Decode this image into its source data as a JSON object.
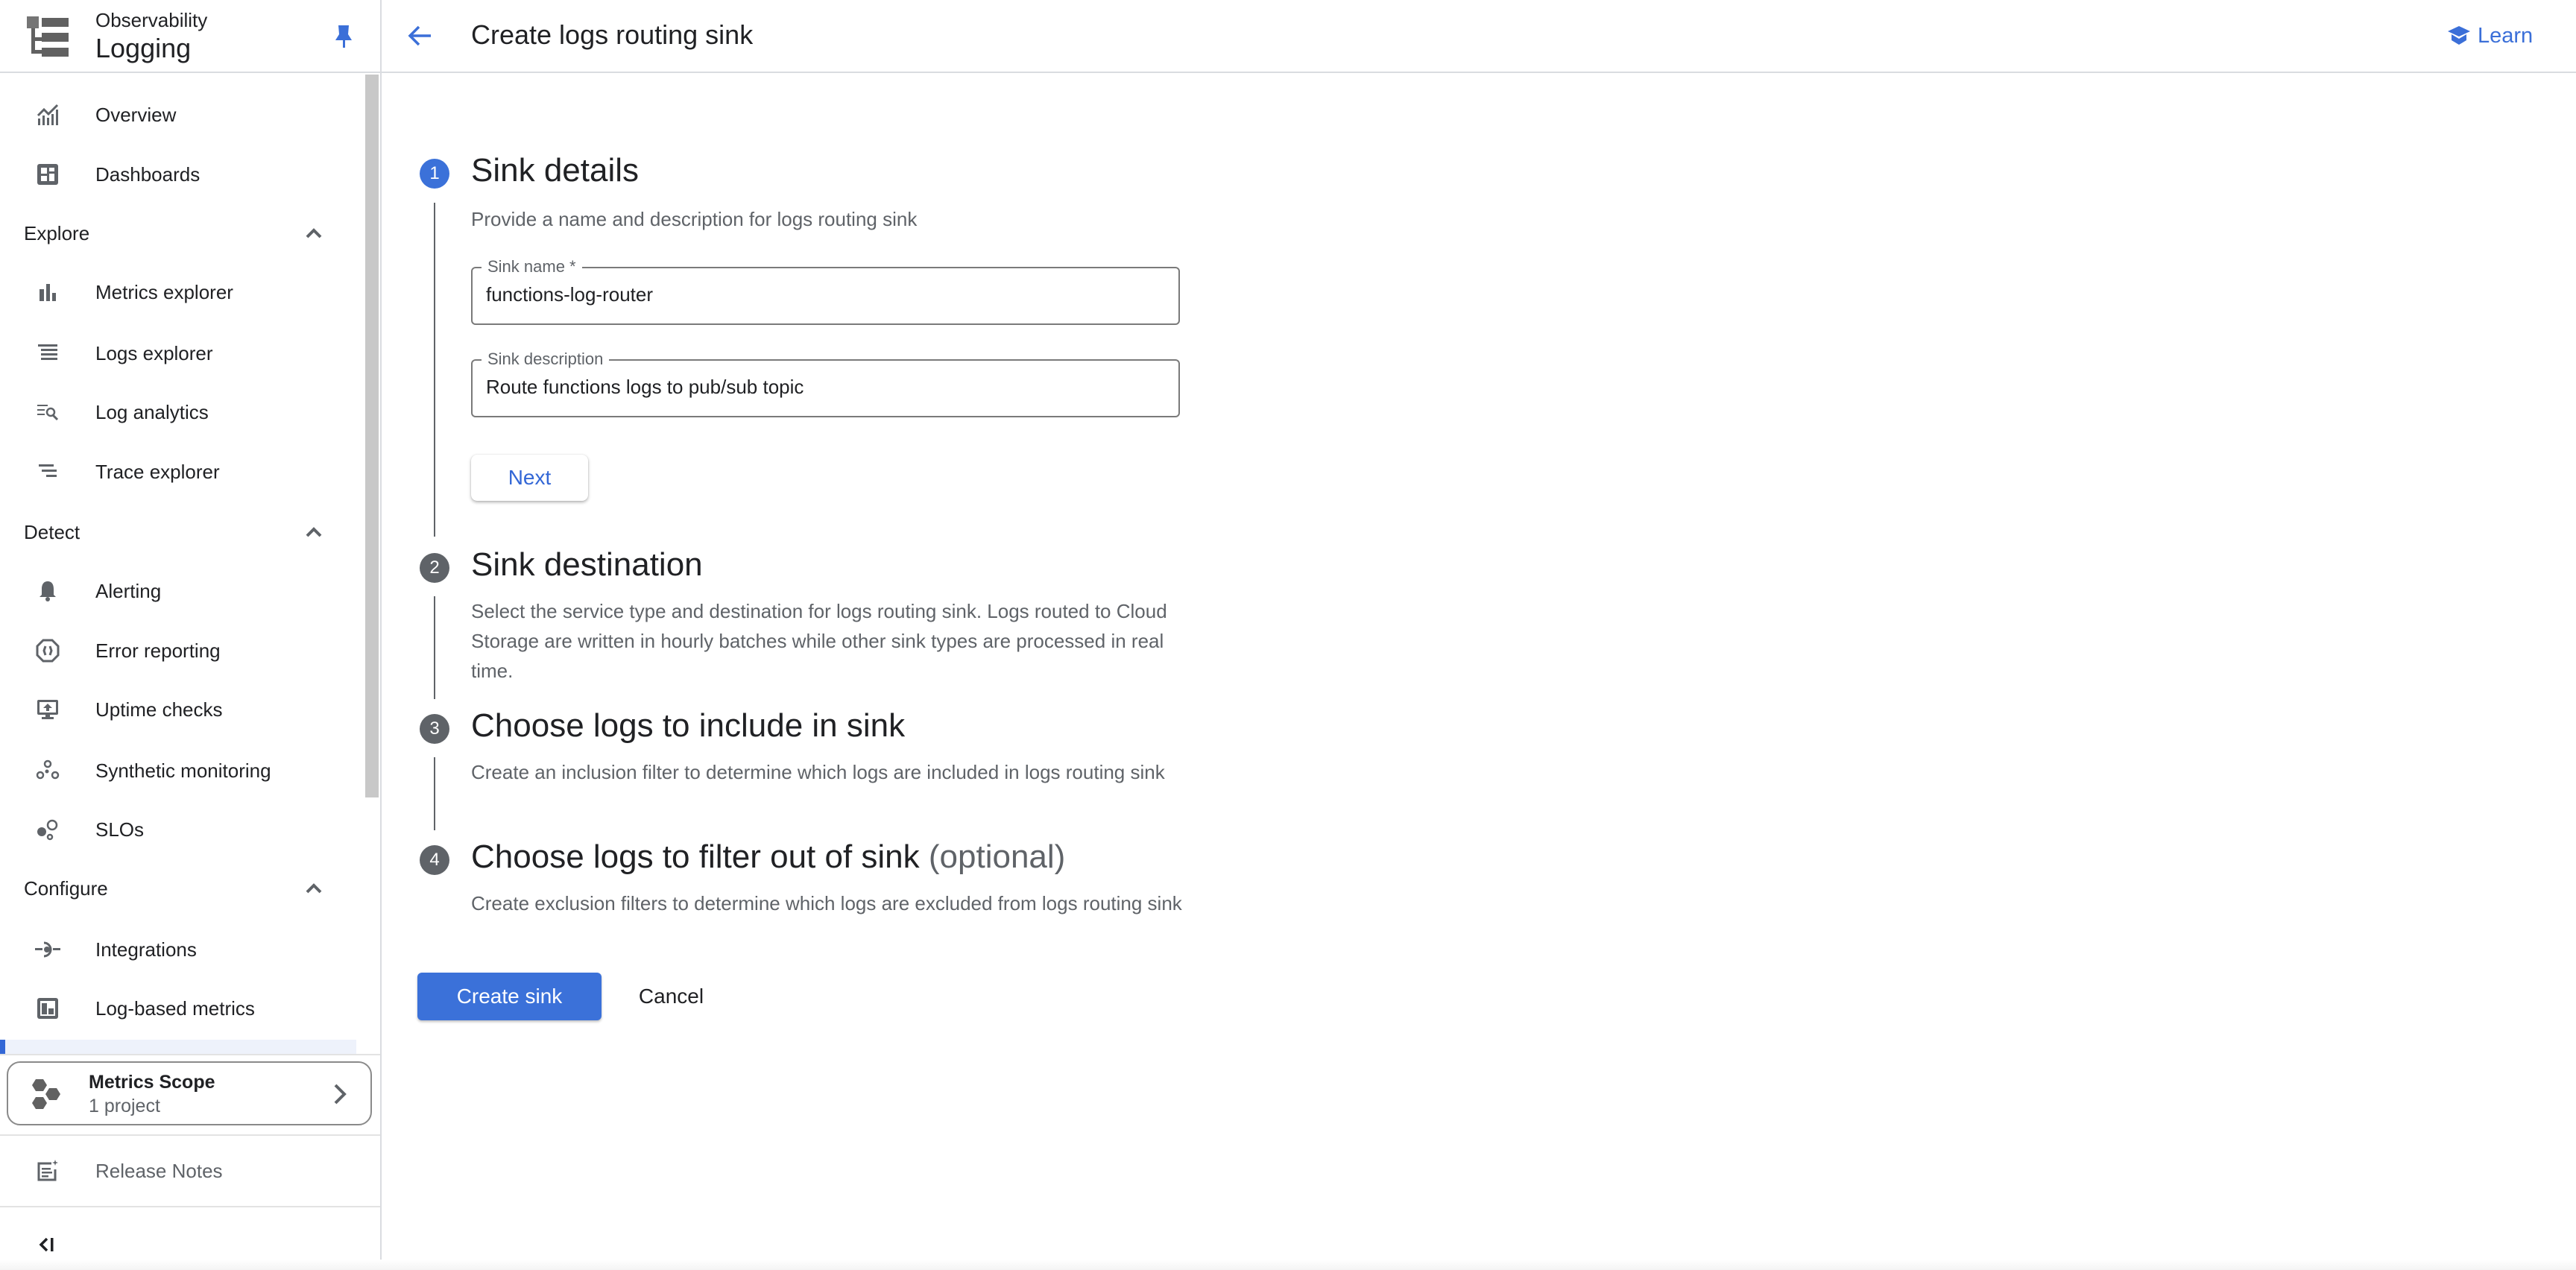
{
  "app": {
    "product_supertitle": "Observability",
    "product_title": "Logging"
  },
  "sidebar": {
    "items_top": [
      {
        "label": "Overview",
        "icon": "overview-chart-icon"
      },
      {
        "label": "Dashboards",
        "icon": "dashboard-icon"
      }
    ],
    "sections": [
      {
        "title": "Explore",
        "expanded": true,
        "items": [
          {
            "label": "Metrics explorer",
            "icon": "bar-chart-icon"
          },
          {
            "label": "Logs explorer",
            "icon": "list-lines-icon"
          },
          {
            "label": "Log analytics",
            "icon": "list-search-icon"
          },
          {
            "label": "Trace explorer",
            "icon": "trace-icon"
          }
        ]
      },
      {
        "title": "Detect",
        "expanded": true,
        "items": [
          {
            "label": "Alerting",
            "icon": "bell-icon"
          },
          {
            "label": "Error reporting",
            "icon": "error-reporting-icon"
          },
          {
            "label": "Uptime checks",
            "icon": "monitor-upload-icon"
          },
          {
            "label": "Synthetic monitoring",
            "icon": "synthetic-circles-icon"
          },
          {
            "label": "SLOs",
            "icon": "slo-circles-icon"
          }
        ]
      },
      {
        "title": "Configure",
        "expanded": true,
        "items": [
          {
            "label": "Integrations",
            "icon": "integrations-icon"
          },
          {
            "label": "Log-based metrics",
            "icon": "log-metrics-icon"
          }
        ]
      }
    ],
    "metrics_scope": {
      "title": "Metrics Scope",
      "subtitle": "1 project"
    },
    "release_notes": "Release Notes",
    "collapse_label": "Collapse navigation"
  },
  "header": {
    "title": "Create logs routing sink",
    "learn_label": "Learn"
  },
  "colors": {
    "accent": "#3367d6",
    "primary_button": "#3b71d9",
    "step_active": "#3b71d9",
    "step_inactive": "#5f6368"
  },
  "steps": [
    {
      "number": "1",
      "title": "Sink details",
      "optional_suffix": "",
      "description": "Provide a name and description for logs routing sink",
      "active": true,
      "fields": [
        {
          "label": "Sink name *",
          "value": "functions-log-router"
        },
        {
          "label": "Sink description",
          "value": "Route functions logs to pub/sub topic"
        }
      ],
      "next_label": "Next"
    },
    {
      "number": "2",
      "title": "Sink destination",
      "optional_suffix": "",
      "description": "Select the service type and destination for logs routing sink. Logs routed to Cloud Storage are written in hourly batches while other sink types are processed in real time.",
      "active": false
    },
    {
      "number": "3",
      "title": "Choose logs to include in sink",
      "optional_suffix": "",
      "description": "Create an inclusion filter to determine which logs are included in logs routing sink",
      "active": false
    },
    {
      "number": "4",
      "title": "Choose logs to filter out of sink",
      "optional_suffix": "(optional)",
      "description": "Create exclusion filters to determine which logs are excluded from logs routing sink",
      "active": false
    }
  ],
  "actions": {
    "create_label": "Create sink",
    "cancel_label": "Cancel"
  }
}
